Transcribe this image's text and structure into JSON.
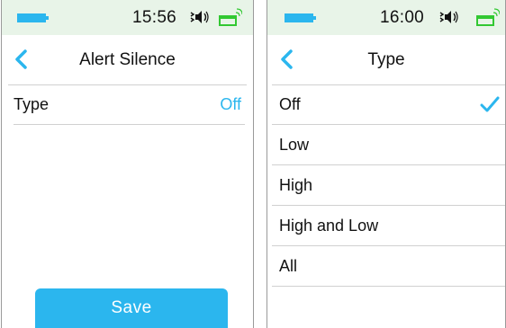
{
  "screen1": {
    "status": {
      "time": "15:56",
      "battery_icon": "battery-icon",
      "sound_icon": "speaker-icon",
      "signal_icon": "signal-icon"
    },
    "header": {
      "title": "Alert Silence",
      "back_icon": "chevron-left-icon"
    },
    "rows": [
      {
        "label": "Type",
        "value": "Off"
      }
    ],
    "save_label": "Save"
  },
  "screen2": {
    "status": {
      "time": "16:00",
      "battery_icon": "battery-icon",
      "sound_icon": "speaker-icon",
      "signal_icon": "signal-icon"
    },
    "header": {
      "title": "Type",
      "back_icon": "chevron-left-icon"
    },
    "options": [
      {
        "label": "Off",
        "selected": true
      },
      {
        "label": "Low",
        "selected": false
      },
      {
        "label": "High",
        "selected": false
      },
      {
        "label": "High and Low",
        "selected": false
      },
      {
        "label": "All",
        "selected": false
      }
    ]
  },
  "colors": {
    "accent": "#2bb6ee",
    "status_bg": "#e8f4e8",
    "battery": "#2bb6ee",
    "signal": "#32c832",
    "divider": "#d0d0d0"
  }
}
